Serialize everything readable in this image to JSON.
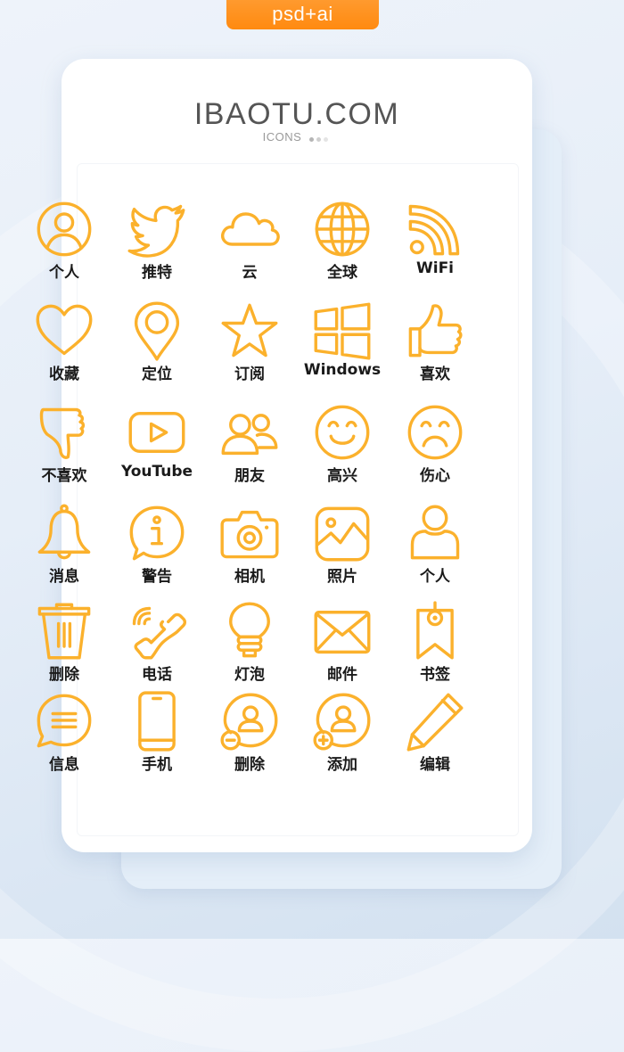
{
  "badge": {
    "label": "psd+ai"
  },
  "header": {
    "title": "IBAOTU.COM",
    "subtitle": "ICONS",
    "dot_colors": [
      "#b5b5b5",
      "#cfcfcf",
      "#e4e4e4"
    ]
  },
  "colors": {
    "icon_stroke": "#fbb12c",
    "badge": "#ff8f1a",
    "label": "#1a1a1a"
  },
  "icons": [
    {
      "icon": "user-circle-icon",
      "label": "个人"
    },
    {
      "icon": "twitter-bird-icon",
      "label": "推特"
    },
    {
      "icon": "cloud-icon",
      "label": "云"
    },
    {
      "icon": "globe-icon",
      "label": "全球"
    },
    {
      "icon": "wifi-rss-icon",
      "label": "WiFi"
    },
    {
      "icon": "heart-icon",
      "label": "收藏"
    },
    {
      "icon": "location-pin-icon",
      "label": "定位"
    },
    {
      "icon": "star-icon",
      "label": "订阅"
    },
    {
      "icon": "windows-logo-icon",
      "label": "Windows"
    },
    {
      "icon": "thumbs-up-icon",
      "label": "喜欢"
    },
    {
      "icon": "thumbs-down-icon",
      "label": "不喜欢"
    },
    {
      "icon": "youtube-play-icon",
      "label": "YouTube"
    },
    {
      "icon": "friends-icon",
      "label": "朋友"
    },
    {
      "icon": "smile-face-icon",
      "label": "高兴"
    },
    {
      "icon": "sad-face-icon",
      "label": "伤心"
    },
    {
      "icon": "bell-icon",
      "label": "消息"
    },
    {
      "icon": "info-bubble-icon",
      "label": "警告"
    },
    {
      "icon": "camera-icon",
      "label": "相机"
    },
    {
      "icon": "photo-icon",
      "label": "照片"
    },
    {
      "icon": "user-icon",
      "label": "个人"
    },
    {
      "icon": "trash-icon",
      "label": "删除"
    },
    {
      "icon": "phone-icon",
      "label": "电话"
    },
    {
      "icon": "lightbulb-icon",
      "label": "灯泡"
    },
    {
      "icon": "mail-icon",
      "label": "邮件"
    },
    {
      "icon": "bookmark-tag-icon",
      "label": "书签"
    },
    {
      "icon": "chat-bubble-icon",
      "label": "信息"
    },
    {
      "icon": "mobile-phone-icon",
      "label": "手机"
    },
    {
      "icon": "remove-user-icon",
      "label": "删除"
    },
    {
      "icon": "add-user-icon",
      "label": "添加"
    },
    {
      "icon": "pencil-edit-icon",
      "label": "编辑"
    }
  ]
}
